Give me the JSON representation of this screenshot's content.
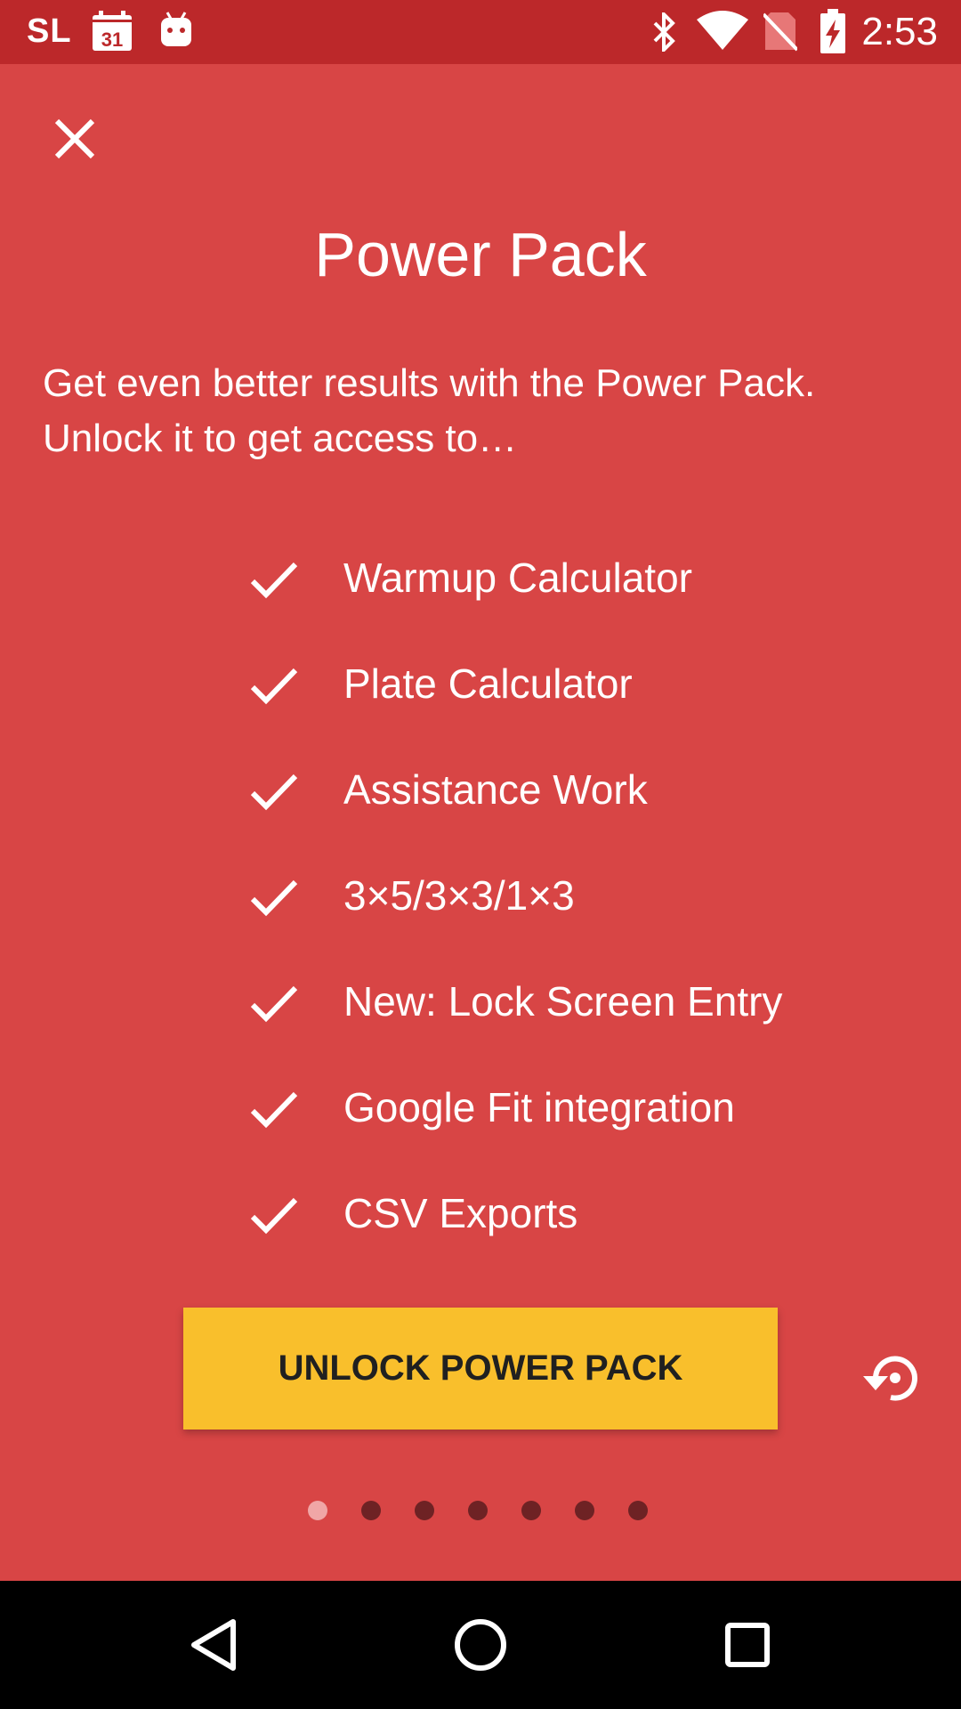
{
  "status_bar": {
    "carrier": "SL",
    "calendar_day": "31",
    "time": "2:53",
    "icons": [
      "calendar-icon",
      "android-icon",
      "bluetooth-icon",
      "wifi-icon",
      "no-sim-icon",
      "battery-charging-icon"
    ]
  },
  "header": {
    "close_icon": "close-icon"
  },
  "main": {
    "title": "Power Pack",
    "intro": "Get even better results with the Power Pack. Unlock it to get access to…",
    "features": [
      "Warmup Calculator",
      "Plate Calculator",
      "Assistance Work",
      "3×5/3×3/1×3",
      "New: Lock Screen Entry",
      "Google Fit integration",
      "CSV Exports"
    ],
    "unlock_button": "UNLOCK POWER PACK",
    "restore_icon": "restore-icon"
  },
  "pager": {
    "total_pages": 7,
    "active_page": 1
  },
  "nav_bar": {
    "icons": [
      "back-icon",
      "home-icon",
      "recents-icon"
    ]
  },
  "colors": {
    "background": "#D84545",
    "status_bar": "#BC282A",
    "button": "#F9BF2C",
    "button_text": "#202020",
    "dot_active": "#F0A6A6",
    "dot_inactive": "#6E2224"
  }
}
